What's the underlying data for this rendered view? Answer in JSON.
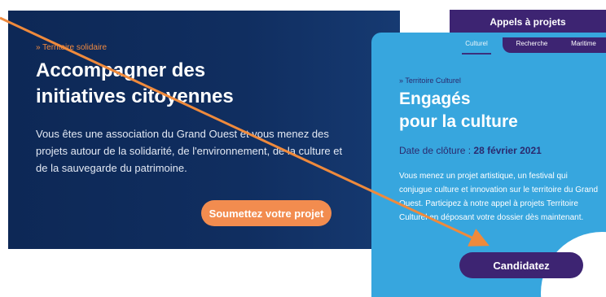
{
  "left": {
    "eyebrow": "» Territoire solidaire",
    "title_line1": "Accompagner des",
    "title_line2": "initiatives citoyennes",
    "description": "Vous êtes une association du Grand Ouest et vous menez des projets autour de la solidarité, de l'environnement, de la culture et de la sauvegarde du patrimoine.",
    "button": "Soumettez votre projet"
  },
  "tabs_header": "Appels à projets",
  "tabs": [
    {
      "label": "Culturel"
    },
    {
      "label": "Recherche"
    },
    {
      "label": "Maritime"
    }
  ],
  "right": {
    "eyebrow": "» Territoire Culturel",
    "title_line1": "Engagés",
    "title_line2": "pour la culture",
    "closing_label": "Date de clôture : ",
    "closing_date": "28 février 2021",
    "description": "Vous menez un projet artistique, un festival qui conjugue culture et innovation sur le territoire du Grand Ouest. Participez à notre appel à projets Territoire Culturel en déposant votre dossier dès maintenant.",
    "button": "Candidatez"
  },
  "colors": {
    "navy": "#0d2856",
    "orange": "#f28c4f",
    "purple": "#3d2472",
    "sky": "#37a6de",
    "arrow": "#ef8a3c"
  }
}
